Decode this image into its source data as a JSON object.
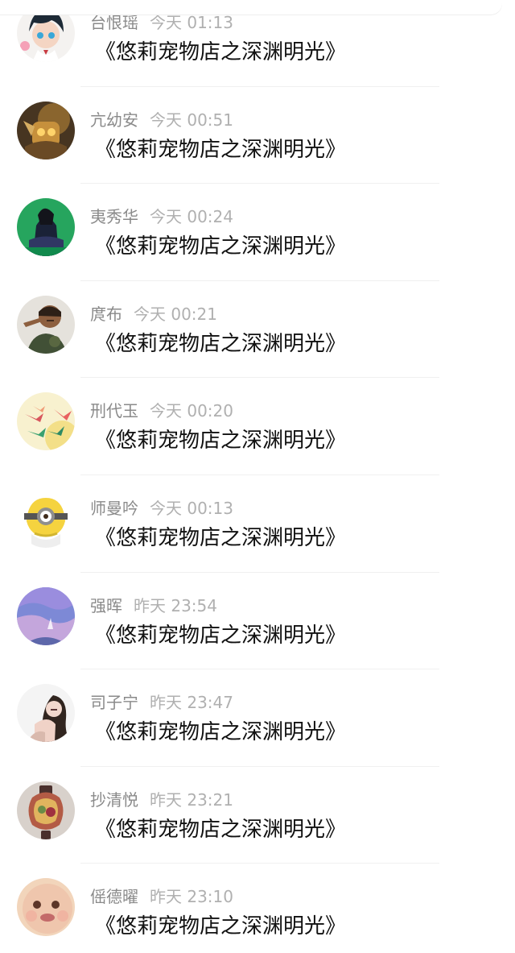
{
  "comments": [
    {
      "user": "台恨瑶",
      "time": "今天 01:13",
      "text": "《悠莉宠物店之深渊明光》",
      "avatar_icon": "anime-boy-avatar-icon"
    },
    {
      "user": "亢幼安",
      "time": "今天 00:51",
      "text": "《悠莉宠物店之深渊明光》",
      "avatar_icon": "robot-avatar-icon"
    },
    {
      "user": "夷秀华",
      "time": "今天 00:24",
      "text": "《悠莉宠物店之深渊明光》",
      "avatar_icon": "girl-green-background-avatar-icon"
    },
    {
      "user": "庹布",
      "time": "今天 00:21",
      "text": "《悠莉宠物店之深渊明光》",
      "avatar_icon": "soldier-avatar-icon"
    },
    {
      "user": "刑代玉",
      "time": "今天 00:20",
      "text": "《悠莉宠物店之深渊明光》",
      "avatar_icon": "paper-crane-avatar-icon"
    },
    {
      "user": "师曼吟",
      "time": "今天 00:13",
      "text": "《悠莉宠物店之深渊明光》",
      "avatar_icon": "minion-avatar-icon"
    },
    {
      "user": "强晖",
      "time": "昨天 23:54",
      "text": "《悠莉宠物店之深渊明光》",
      "avatar_icon": "purple-sky-avatar-icon"
    },
    {
      "user": "司子宁",
      "time": "昨天 23:47",
      "text": "《悠莉宠物店之深渊明光》",
      "avatar_icon": "woman-portrait-avatar-icon"
    },
    {
      "user": "抄清悦",
      "time": "昨天 23:21",
      "text": "《悠莉宠物店之深渊明光》",
      "avatar_icon": "lantern-avatar-icon"
    },
    {
      "user": "傜德曜",
      "time": "昨天 23:10",
      "text": "《悠莉宠物店之深渊明光》",
      "avatar_icon": "baby-face-avatar-icon"
    }
  ]
}
